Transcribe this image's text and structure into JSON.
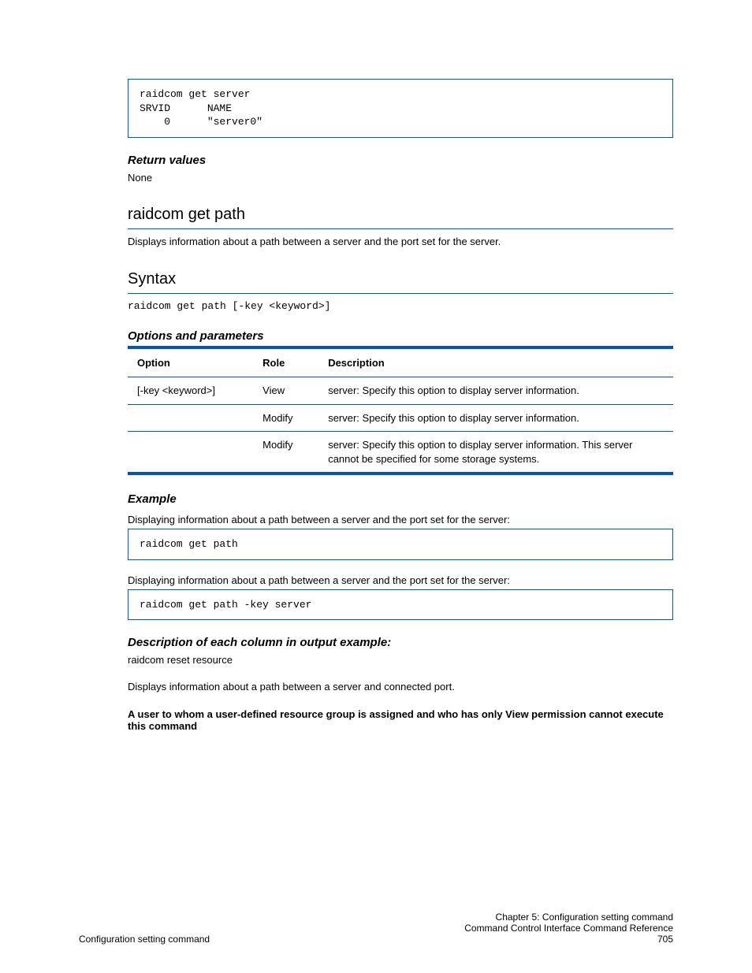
{
  "example_codebox": {
    "line1": "raidcom get server",
    "line2": "SRVID      NAME",
    "line3": "    0      \"server0\""
  },
  "return_values_heading": "Return values",
  "return_values_body": "None",
  "raidcom_get_path": {
    "heading": "raidcom get path",
    "body": "Displays information about a path between a server and the port set for the server.",
    "syntax_heading": "Syntax",
    "syntax_code": "raidcom get path [-key <keyword>]",
    "options_heading": "Options and parameters",
    "table": {
      "headers": [
        "Option",
        "Role",
        "Description"
      ],
      "rows": [
        {
          "opt": "[-key <keyword>]",
          "role": "View",
          "desc": "server: Specify this option to display server information."
        },
        {
          "opt": "",
          "role": "Modify",
          "desc": "server: Specify this option to display server information."
        },
        {
          "opt": "",
          "role": "Modify",
          "desc": "server: Specify this option to display server information. This server cannot be specified for some storage systems."
        }
      ]
    },
    "example_heading": "Example",
    "example_sub1": "Displaying information about a path between a server and the port set for the server:",
    "example_code1": "raidcom get path",
    "example_sub2": "Displaying information about a path between a server and the port set for the server:",
    "example_code2": "raidcom get path -key server",
    "desc_heading": "Description of each column in output example:",
    "desc_body": "raidcom reset resource",
    "reset_body": "Displays information about a path between a server and connected port.",
    "permission_note": "A user to whom a user-defined resource group is assigned and who has only View permission cannot execute this command"
  },
  "footer": {
    "left": "Configuration setting command",
    "right_line1": "Chapter 5: Configuration setting command",
    "right_line2": "Command Control Interface Command Reference",
    "page": "705"
  }
}
